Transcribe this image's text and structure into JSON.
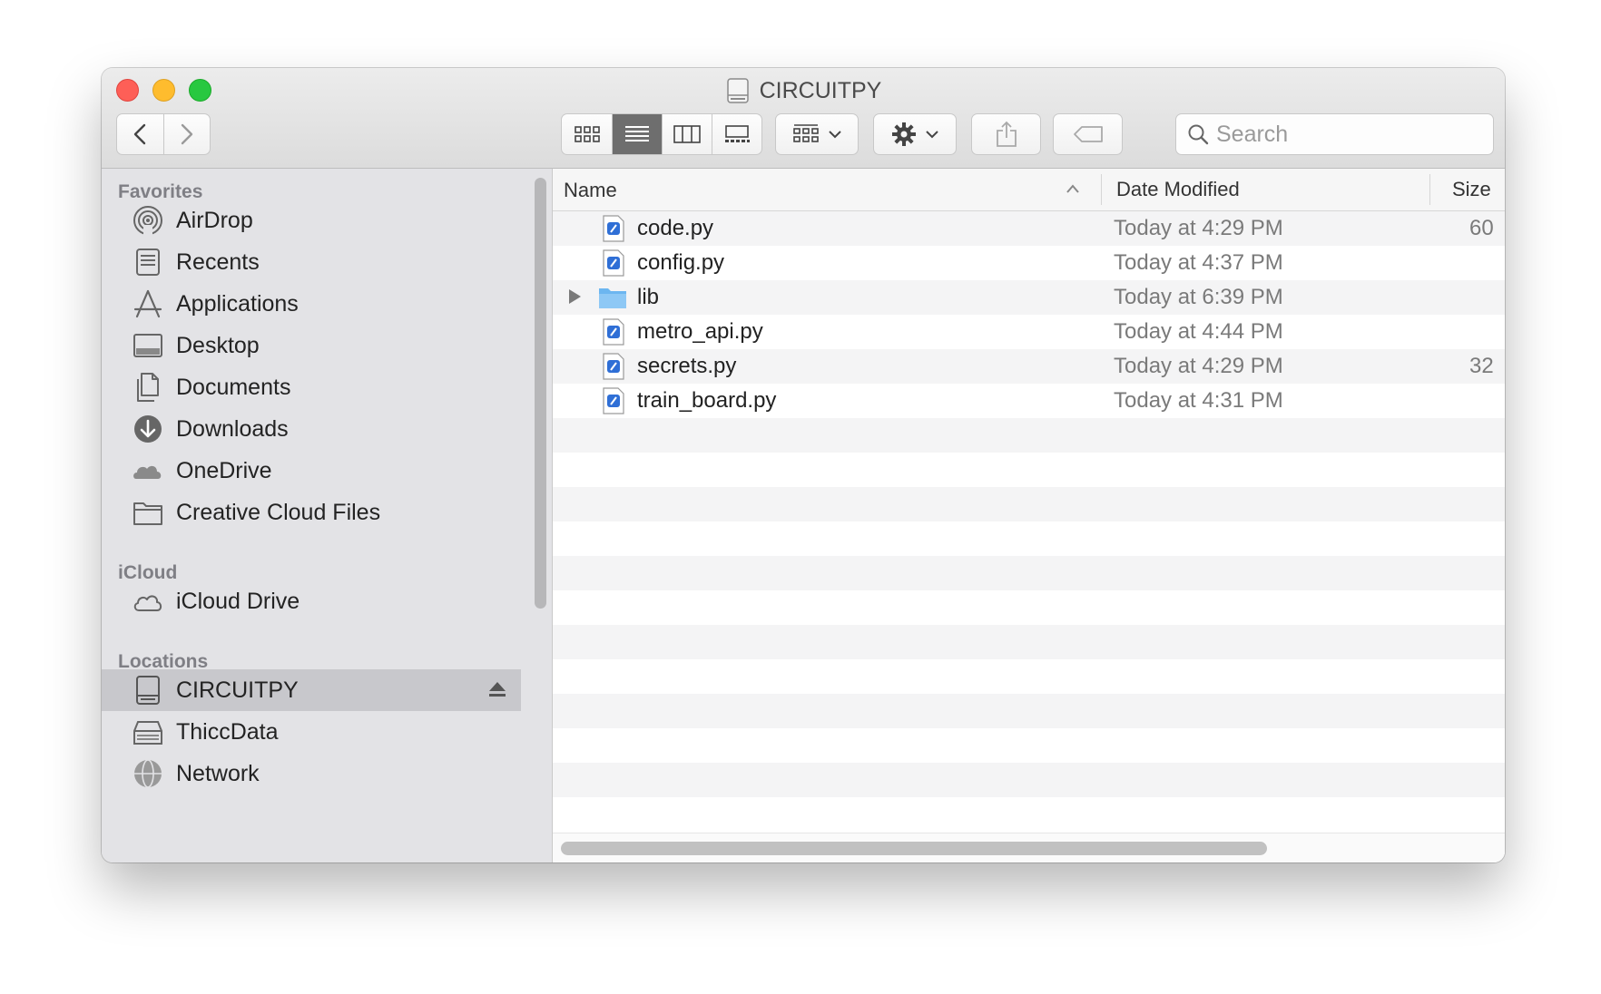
{
  "window": {
    "title": "CIRCUITPY"
  },
  "toolbar": {
    "back": "back",
    "forward": "forward",
    "search_placeholder": "Search"
  },
  "sidebar": {
    "favorites_header": "Favorites",
    "favorites": [
      {
        "label": "AirDrop",
        "icon": "airdrop-icon"
      },
      {
        "label": "Recents",
        "icon": "recents-icon"
      },
      {
        "label": "Applications",
        "icon": "applications-icon"
      },
      {
        "label": "Desktop",
        "icon": "desktop-icon"
      },
      {
        "label": "Documents",
        "icon": "documents-icon"
      },
      {
        "label": "Downloads",
        "icon": "downloads-icon"
      },
      {
        "label": "OneDrive",
        "icon": "onedrive-icon"
      },
      {
        "label": "Creative Cloud Files",
        "icon": "folder-icon"
      }
    ],
    "icloud_header": "iCloud",
    "icloud": [
      {
        "label": "iCloud Drive",
        "icon": "icloud-icon"
      }
    ],
    "locations_header": "Locations",
    "locations": [
      {
        "label": "CIRCUITPY",
        "icon": "drive-icon",
        "selected": true
      },
      {
        "label": "ThiccData",
        "icon": "external-drive-icon"
      },
      {
        "label": "Network",
        "icon": "network-icon"
      }
    ]
  },
  "file_list": {
    "columns": {
      "name": "Name",
      "date": "Date Modified",
      "size": "Size"
    },
    "rows": [
      {
        "name": "code.py",
        "date": "Today at 4:29 PM",
        "size": "60",
        "kind": "python"
      },
      {
        "name": "config.py",
        "date": "Today at 4:37 PM",
        "size": "",
        "kind": "python"
      },
      {
        "name": "lib",
        "date": "Today at 6:39 PM",
        "size": "",
        "kind": "folder"
      },
      {
        "name": "metro_api.py",
        "date": "Today at 4:44 PM",
        "size": "",
        "kind": "python"
      },
      {
        "name": "secrets.py",
        "date": "Today at 4:29 PM",
        "size": "32",
        "kind": "python"
      },
      {
        "name": "train_board.py",
        "date": "Today at 4:31 PM",
        "size": "",
        "kind": "python"
      }
    ]
  },
  "colors": {
    "close": "#fe5f57",
    "minimize": "#febc2e",
    "maximize": "#28c840",
    "sidebar_bg": "#e3e3e6",
    "selected_bg": "#c8c8cc",
    "folder": "#6cb6f0"
  }
}
